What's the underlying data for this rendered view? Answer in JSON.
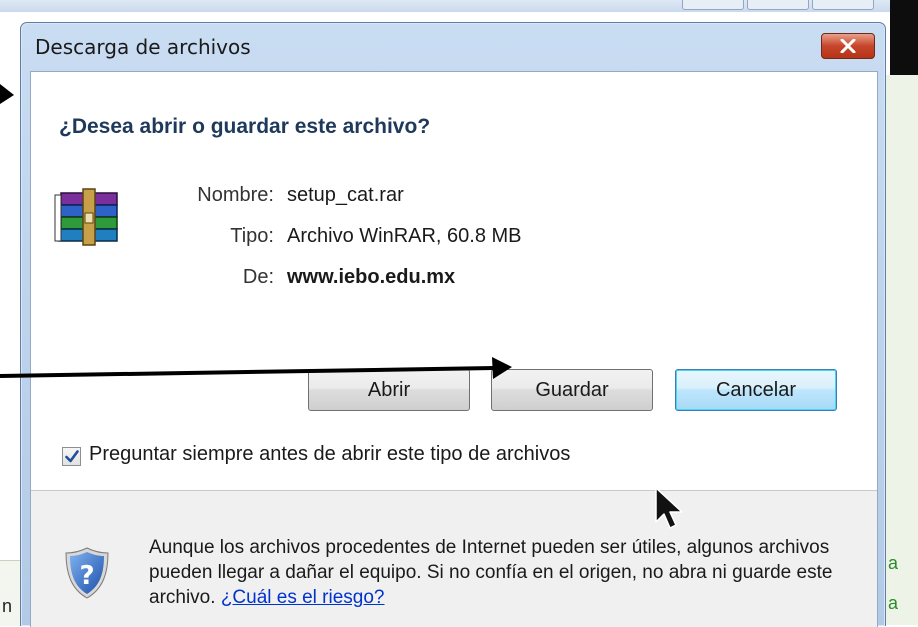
{
  "dialog": {
    "title": "Descarga de archivos",
    "question": "¿Desea abrir o guardar este archivo?",
    "file": {
      "icon": "winrar-archive-icon",
      "name_label": "Nombre:",
      "name_value": "setup_cat.rar",
      "type_label": "Tipo:",
      "type_value": "Archivo WinRAR, 60.8 MB",
      "from_label": "De:",
      "from_value": "www.iebo.edu.mx"
    },
    "buttons": {
      "open": "Abrir",
      "save": "Guardar",
      "cancel": "Cancelar"
    },
    "always_ask": {
      "label": "Preguntar siempre antes de abrir este tipo de archivos",
      "checked": true
    },
    "warning": {
      "text": "Aunque los archivos procedentes de Internet pueden ser útiles, algunos archivos pueden llegar a dañar el equipo. Si no confía en el origen, no abra ni guarde este archivo. ",
      "link": "¿Cuál es el riesgo?"
    }
  },
  "background": {
    "right_texts": [
      "a",
      "a"
    ],
    "left_text": "n"
  },
  "colors": {
    "heading": "#1e395b",
    "link": "#0033cc",
    "close_button": "#c7452a",
    "default_button_border": "#3c7fb1"
  }
}
